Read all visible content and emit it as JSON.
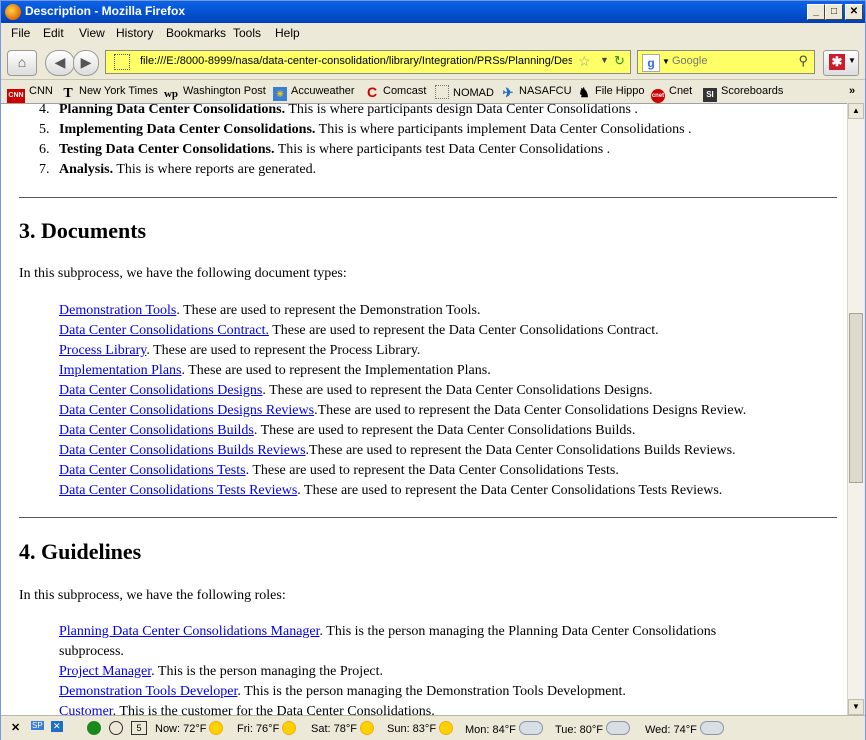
{
  "window": {
    "title": "Description - Mozilla Firefox"
  },
  "menu": [
    "File",
    "Edit",
    "View",
    "History",
    "Bookmarks",
    "Tools",
    "Help"
  ],
  "nav": {
    "url": "file:///E:/8000-8999/nasa/data-center-consolidation/library/Integration/PRSs/Planning/Des",
    "search_placeholder": "Google"
  },
  "bookmarks": [
    "CNN",
    "New York Times",
    "Washington Post",
    "Accuweather",
    "Comcast",
    "NOMAD",
    "NASAFCU",
    "File Hippo",
    "Cnet",
    "Scoreboards"
  ],
  "content": {
    "list_items": [
      {
        "num": "4.",
        "bold": "Planning Data Center Consolidations.",
        "text": " This is where participants design Data Center Consolidations ."
      },
      {
        "num": "5.",
        "bold": "Implementing Data Center Consolidations.",
        "text": " This is where participants implement Data Center Consolidations ."
      },
      {
        "num": "6.",
        "bold": "Testing Data Center Consolidations.",
        "text": " This is where participants test Data Center Consolidations ."
      },
      {
        "num": "7.",
        "bold": "Analysis.",
        "text": " This is where reports are generated."
      }
    ],
    "documents": {
      "heading": "3. Documents",
      "intro": "In this subprocess, we have the following document types:",
      "items": [
        {
          "link": "Demonstration Tools",
          "text": ". These are used to represent the Demonstration Tools."
        },
        {
          "link": "Data Center Consolidations Contract.",
          "text": " These are used to represent the Data Center Consolidations Contract."
        },
        {
          "link": "Process Library",
          "text": ". These are used to represent the Process Library."
        },
        {
          "link": "Implementation Plans",
          "text": ". These are used to represent the Implementation Plans."
        },
        {
          "link": "Data Center Consolidations Designs",
          "text": ". These are used to represent the Data Center Consolidations Designs."
        },
        {
          "link": "Data Center Consolidations Designs Reviews",
          "text": ".These are used to represent the Data Center Consolidations Designs Review."
        },
        {
          "link": "Data Center Consolidations Builds",
          "text": ". These are used to represent the Data Center Consolidations Builds."
        },
        {
          "link": "Data Center Consolidations Builds Reviews",
          "text": ".These are used to represent the Data Center Consolidations Builds Reviews."
        },
        {
          "link": "Data Center Consolidations Tests",
          "text": ". These are used to represent the Data Center Consolidations Tests."
        },
        {
          "link": "Data Center Consolidations Tests Reviews",
          "text": ". These are used to represent the Data Center Consolidations Tests Reviews."
        }
      ]
    },
    "guidelines": {
      "heading": "4. Guidelines",
      "intro": "In this subprocess, we have the following roles:",
      "items": [
        {
          "link": "Planning Data Center Consolidations Manager",
          "text": ". This is the person managing the Planning Data Center Consolidations subprocess."
        },
        {
          "link": "Project Manager",
          "text": ". This is the person managing the Project."
        },
        {
          "link": "Demonstration Tools Developer",
          "text": ". This is the person managing the Demonstration Tools Development."
        },
        {
          "link": "Customer",
          "text": ". This is the customer for the Data Center Consolidations."
        }
      ]
    }
  },
  "status": {
    "weather": [
      {
        "label": "Now: 72°F",
        "icon": "sun-icon"
      },
      {
        "label": "Fri: 76°F",
        "icon": "sun-icon"
      },
      {
        "label": "Sat: 78°F",
        "icon": "sun-icon"
      },
      {
        "label": "Sun: 83°F",
        "icon": "sun-icon"
      },
      {
        "label": "Mon: 84°F",
        "icon": "partly-cloudy-icon"
      },
      {
        "label": "Tue: 80°F",
        "icon": "partly-cloudy-icon"
      },
      {
        "label": "Wed: 74°F",
        "icon": "cloud-icon"
      }
    ],
    "calendar_day": "5"
  }
}
